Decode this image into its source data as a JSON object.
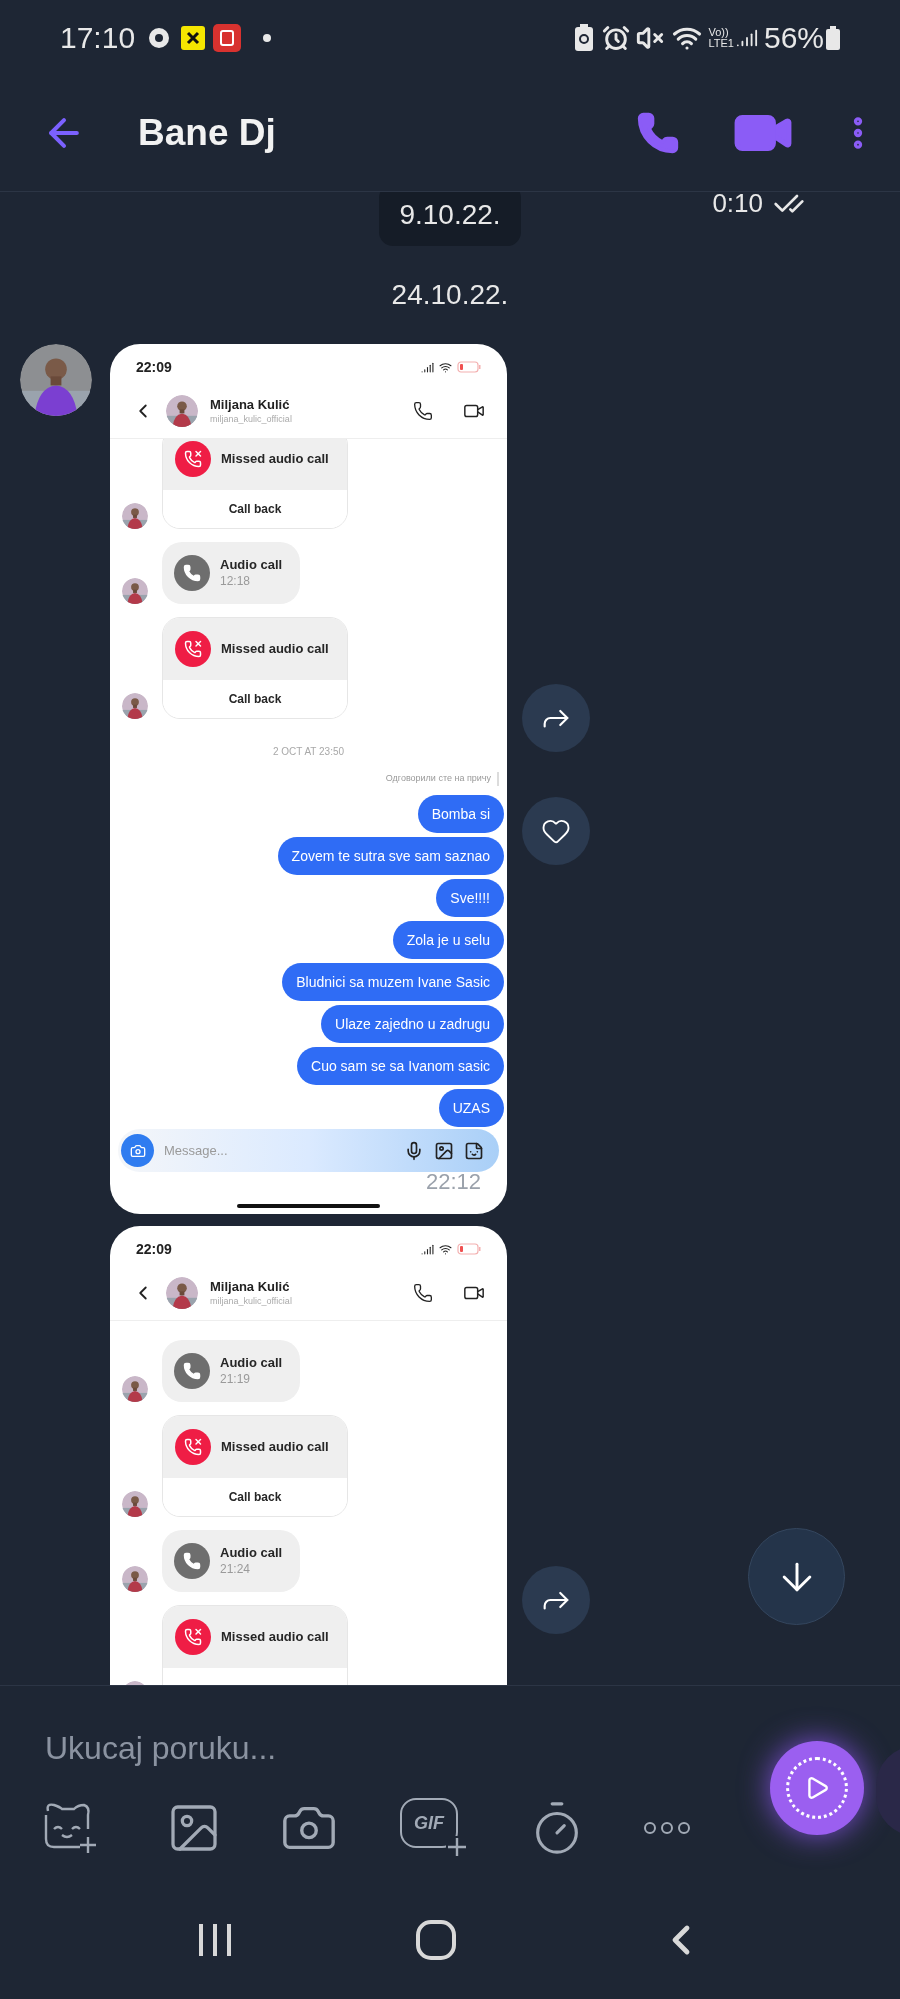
{
  "status_bar": {
    "time": "17:10",
    "network_top": "Vo))",
    "network_bottom": "LTE1",
    "battery": "56%"
  },
  "header": {
    "title": "Bane Dj"
  },
  "chat": {
    "top_time": "0:10",
    "date_pill": "9.10.22.",
    "date": "24.10.22.",
    "screenshots": [
      {
        "time": "22:09",
        "contact_name": "Miljana Kulić",
        "contact_handle": "miljana_kulic_official",
        "composer_placeholder": "Message...",
        "sent_time": "22:12",
        "messages": [
          {
            "kind": "missed_call",
            "title": "Missed audio call",
            "action": "Call back"
          },
          {
            "kind": "audio_call",
            "title": "Audio call",
            "time": "12:18"
          },
          {
            "kind": "missed_call",
            "title": "Missed audio call",
            "action": "Call back"
          },
          {
            "kind": "date",
            "text": "2 OCT AT 23:50"
          },
          {
            "kind": "reply_note",
            "text": "Одговорили сте на причу"
          },
          {
            "kind": "sent",
            "text": "Bomba si"
          },
          {
            "kind": "sent",
            "text": "Zovem te sutra sve sam saznao"
          },
          {
            "kind": "sent",
            "text": "Sve!!!!"
          },
          {
            "kind": "sent",
            "text": "Zola je u selu"
          },
          {
            "kind": "sent",
            "text": "Bludnici sa muzem Ivane Sasic"
          },
          {
            "kind": "sent",
            "text": "Ulaze zajedno u zadrugu"
          },
          {
            "kind": "sent",
            "text": "Cuo sam se sa Ivanom sasic"
          },
          {
            "kind": "sent",
            "text": "UZAS"
          }
        ]
      },
      {
        "time": "22:09",
        "contact_name": "Miljana Kulić",
        "contact_handle": "miljana_kulic_official",
        "messages": [
          {
            "kind": "audio_call",
            "title": "Audio call",
            "time": "21:19"
          },
          {
            "kind": "missed_call",
            "title": "Missed audio call",
            "action": "Call back"
          },
          {
            "kind": "audio_call",
            "title": "Audio call",
            "time": "21:24"
          },
          {
            "kind": "missed_call",
            "title": "Missed audio call"
          }
        ]
      }
    ]
  },
  "composer": {
    "placeholder": "Ukucaj poruku...",
    "gif_label": "GIF"
  }
}
